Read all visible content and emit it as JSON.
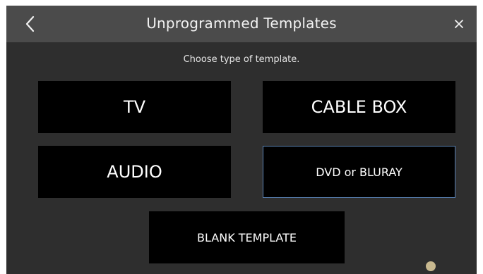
{
  "header": {
    "title": "Unprogrammed Templates",
    "back_icon": "chevron-left-icon",
    "close_icon": "close-icon"
  },
  "prompt": "Choose type of template.",
  "templates": [
    {
      "label": "TV",
      "selected": false
    },
    {
      "label": "CABLE BOX",
      "selected": false
    },
    {
      "label": "AUDIO",
      "selected": false
    },
    {
      "label": "DVD or BLURAY",
      "selected": true
    },
    {
      "label": "BLANK TEMPLATE",
      "selected": false
    }
  ],
  "colors": {
    "header_bg": "#4b4b4b",
    "screen_bg": "#2e2e2e",
    "tile_bg": "#000000",
    "selected_border": "#5a82b4",
    "scroll_indicator": "#c8b98f"
  }
}
